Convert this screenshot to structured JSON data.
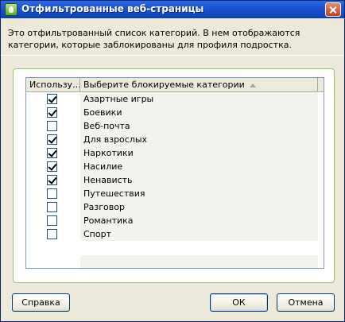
{
  "window": {
    "title": "Отфильтрованные веб-страницы"
  },
  "description": "Это отфильтрованный список категорий. В нем отображаются категории, которые заблокированы для профиля подростка.",
  "table": {
    "columns": [
      "Использу...",
      "Выберите блокируемые категории"
    ],
    "rows": [
      {
        "label": "Азартные игры",
        "checked": true
      },
      {
        "label": "Боевики",
        "checked": true
      },
      {
        "label": "Веб-почта",
        "checked": false
      },
      {
        "label": "Для взрослых",
        "checked": true
      },
      {
        "label": "Наркотики",
        "checked": true
      },
      {
        "label": "Насилие",
        "checked": true
      },
      {
        "label": "Ненависть",
        "checked": true
      },
      {
        "label": "Путешествия",
        "checked": false
      },
      {
        "label": "Разговор",
        "checked": false
      },
      {
        "label": "Романтика",
        "checked": false
      },
      {
        "label": "Спорт",
        "checked": false
      }
    ]
  },
  "buttons": {
    "help": "Справка",
    "ok": "ОК",
    "cancel": "Отмена"
  },
  "colors": {
    "titlebar": "#0c3fb7",
    "frame_border": "#9ac46b",
    "dialog_bg": "#ece9d8"
  }
}
